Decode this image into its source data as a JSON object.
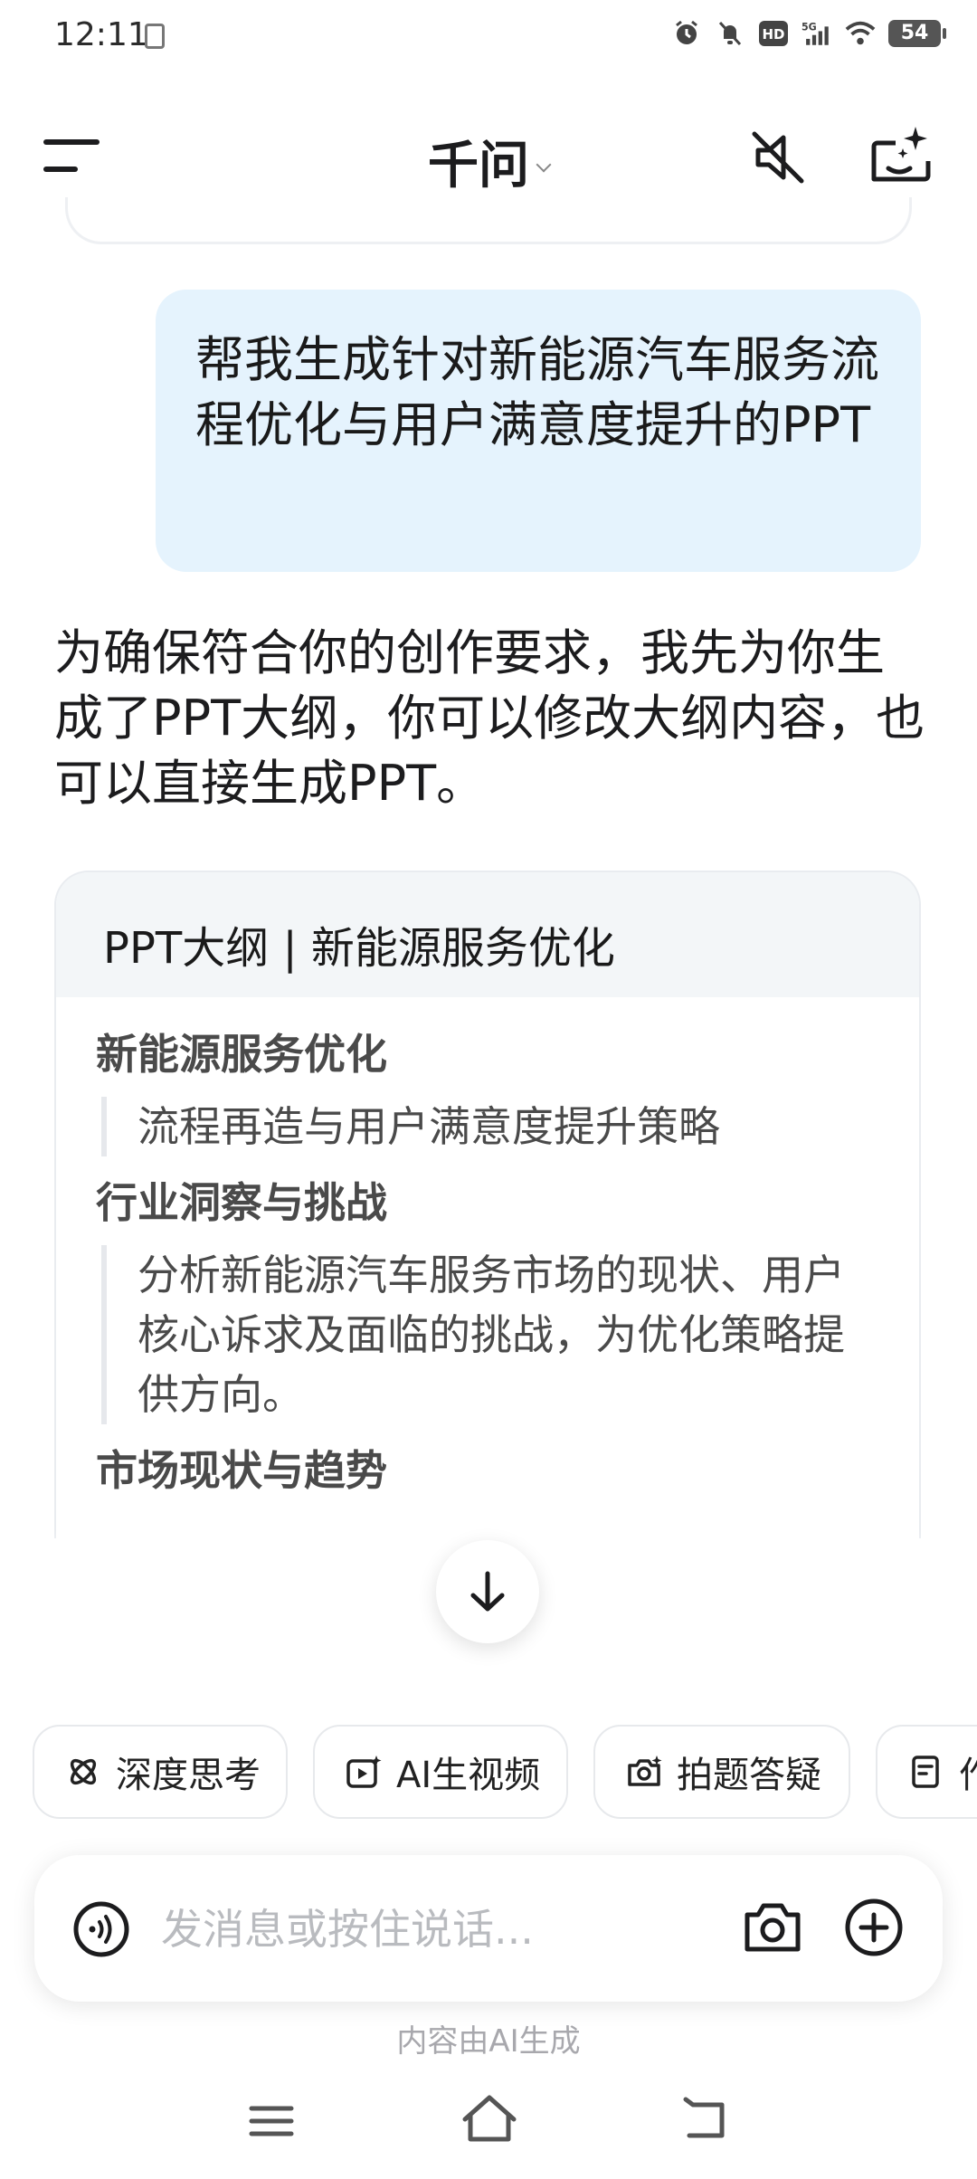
{
  "status_bar": {
    "time": "12:11",
    "network": "5G",
    "hd": "HD",
    "battery": "54"
  },
  "header": {
    "title": "千问"
  },
  "chat": {
    "user_message": "帮我生成针对新能源汽车服务流程优化与用户满意度提升的PPT",
    "ai_reply": "为确保符合你的创作要求，我先为你生成了PPT大纲，你可以修改大纲内容，也可以直接生成PPT。"
  },
  "outline": {
    "header": "PPT大纲 | 新能源服务优化",
    "sections": [
      {
        "title": "新能源服务优化",
        "desc": "流程再造与用户满意度提升策略"
      },
      {
        "title": "行业洞察与挑战",
        "desc": "分析新能源汽车服务市场的现状、用户核心诉求及面临的挑战，为优化策略提供方向。"
      },
      {
        "title": "市场现状与趋势",
        "desc": ""
      }
    ]
  },
  "chips": [
    {
      "label": "深度思考",
      "icon": "deep-think-icon"
    },
    {
      "label": "AI生视频",
      "icon": "ai-video-icon"
    },
    {
      "label": "拍题答疑",
      "icon": "photo-question-icon"
    },
    {
      "label": "作",
      "icon": "writing-icon"
    }
  ],
  "input": {
    "placeholder": "发消息或按住说话..."
  },
  "disclaimer": "内容由AI生成",
  "colors": {
    "user_bubble": "#e5f3fd",
    "outline_header": "#f3f6f8",
    "text_primary": "#1c1c1e",
    "placeholder": "#b9bbbf"
  }
}
